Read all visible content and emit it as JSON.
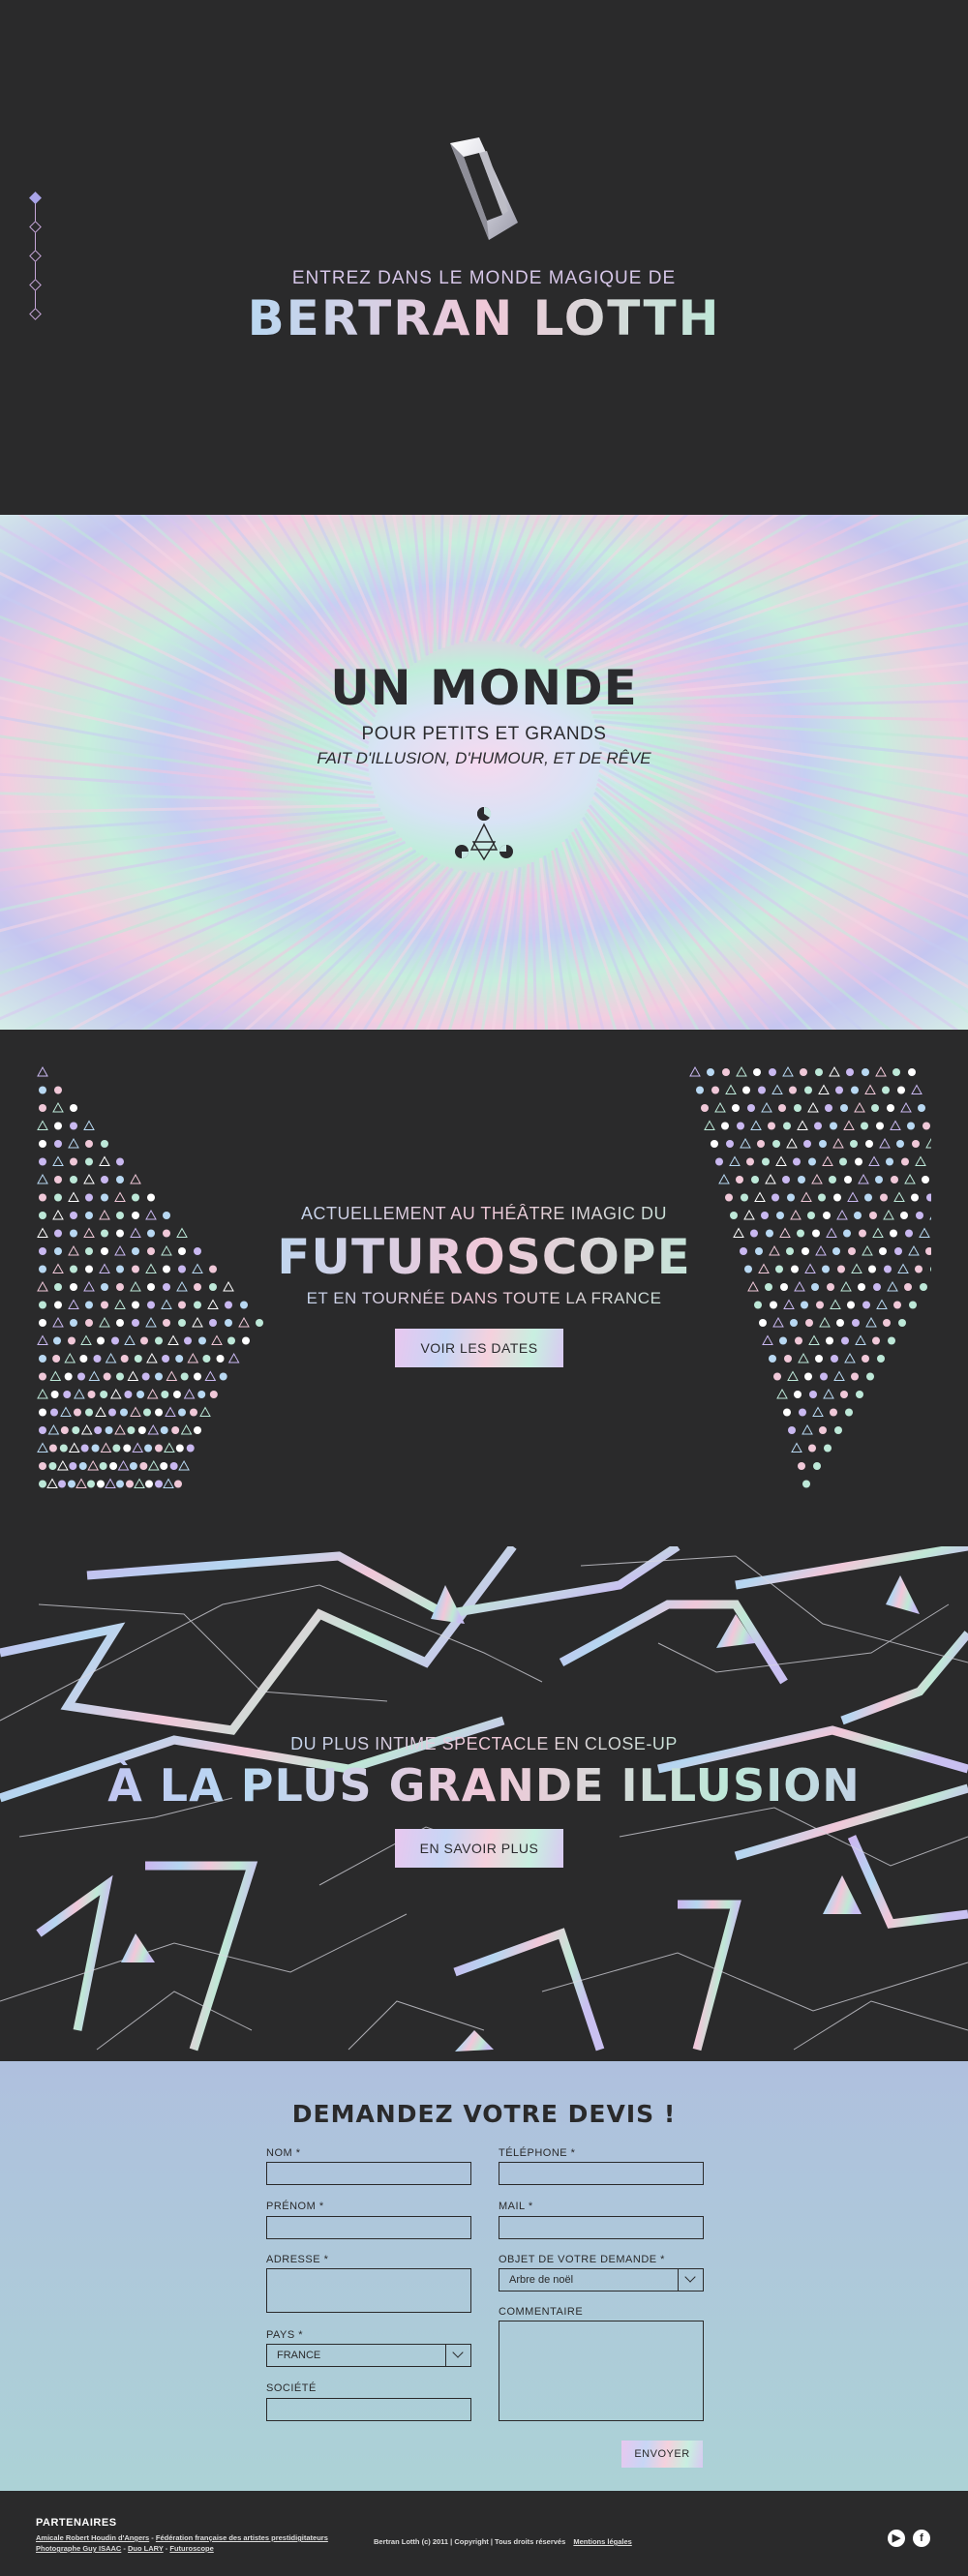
{
  "hero": {
    "intro": "ENTREZ DANS LE MONDE MAGIQUE DE",
    "title": "BERTRAN LOTTH"
  },
  "side_nav": {
    "count": 5,
    "active_index": 0
  },
  "holo": {
    "title": "UN MONDE",
    "subtitle": "POUR PETITS ET GRANDS",
    "tagline": "FAIT D'ILLUSION, D'HUMOUR, ET DE RÊVE"
  },
  "futuro": {
    "intro": "ACTUELLEMENT AU THÉÂTRE IMAGIC DU",
    "title": "FUTUROSCOPE",
    "subtitle": "ET EN TOURNÉE DANS TOUTE LA FRANCE",
    "button": "VOIR LES DATES"
  },
  "illusion": {
    "intro": "DU PLUS INTIME SPECTACLE EN CLOSE-UP",
    "title": "À LA PLUS GRANDE ILLUSION",
    "button": "EN SAVOIR PLUS"
  },
  "quote": {
    "title": "DEMANDEZ VOTRE DEVIS !",
    "labels": {
      "nom": "NOM *",
      "prenom": "PRÉNOM *",
      "adresse": "ADRESSE *",
      "pays": "PAYS *",
      "societe": "SOCIÉTÉ",
      "telephone": "TÉLÉPHONE *",
      "mail": "MAIL *",
      "objet": "OBJET DE VOTRE DEMANDE *",
      "commentaire": "COMMENTAIRE"
    },
    "country_value": "FRANCE",
    "subject_value": "Arbre de noël",
    "send": "ENVOYER"
  },
  "footer": {
    "partners_title": "PARTENAIRES",
    "partners": [
      "Amicale Robert Houdin d'Angers",
      "Fédération française des artistes prestidigitateurs",
      "Photographe Guy ISAAC",
      "Duo LARY",
      "Futuroscope"
    ],
    "copyright": "Bertran Lotth (c) 2011 | Copyright | Tous droits réservés",
    "legal": "Mentions légales",
    "social": [
      "youtube-icon",
      "facebook-icon"
    ]
  },
  "colors": {
    "dark": "#2a2a2b",
    "holo_1": "#c9b8f0",
    "holo_2": "#b8d8f2",
    "holo_3": "#f0c8d8",
    "holo_4": "#bde8d8",
    "form_top": "#afc0de",
    "form_bottom": "#acd2d6"
  }
}
